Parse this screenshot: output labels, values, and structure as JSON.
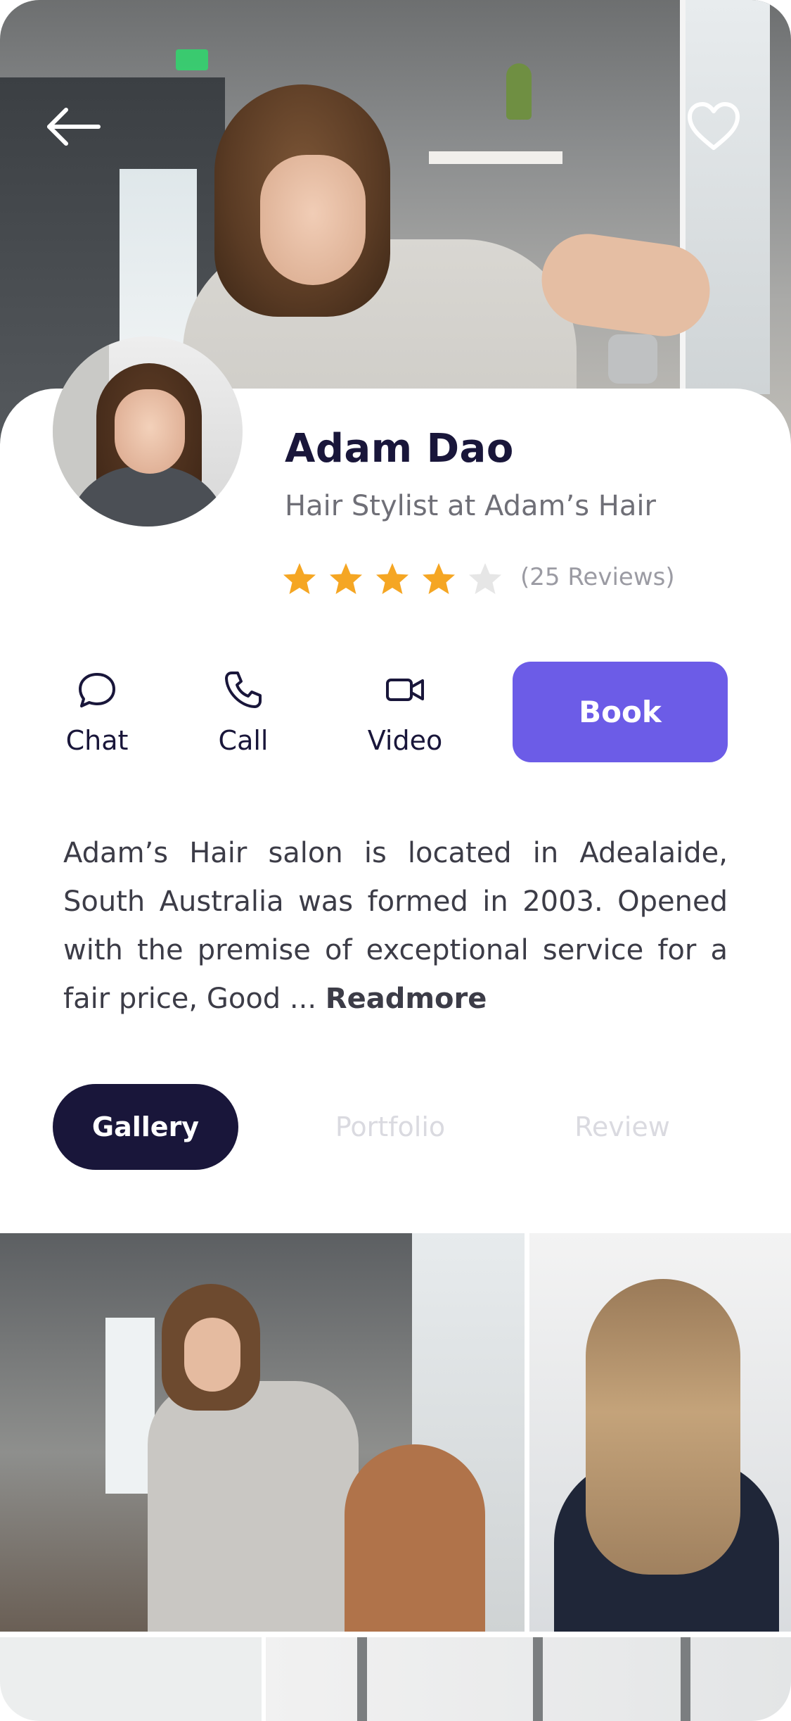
{
  "profile": {
    "name": "Adam Dao",
    "title": "Hair Stylist at Adam’s Hair",
    "rating": 4,
    "rating_max": 5,
    "reviews_label": "(25 Reviews)"
  },
  "colors": {
    "accent": "#6c5ce7",
    "dark": "#19163a",
    "star_filled": "#f5a623",
    "star_empty": "#e6e6e6"
  },
  "actions": [
    {
      "label": "Chat",
      "icon": "chat-bubble-icon"
    },
    {
      "label": "Call",
      "icon": "phone-icon"
    },
    {
      "label": "Video",
      "icon": "video-camera-icon"
    }
  ],
  "book_label": "Book",
  "description": {
    "text": "Adam’s Hair salon is located in Adealaide, South Australia was formed in 2003. Opened with the premise of exceptional service for a fair price, Good ... ",
    "more_label": "Readmore"
  },
  "tabs": [
    {
      "label": "Gallery",
      "active": true
    },
    {
      "label": "Portfolio",
      "active": false
    },
    {
      "label": "Review",
      "active": false
    }
  ],
  "header": {
    "back_icon": "arrow-left-icon",
    "favorite_icon": "heart-outline-icon"
  }
}
